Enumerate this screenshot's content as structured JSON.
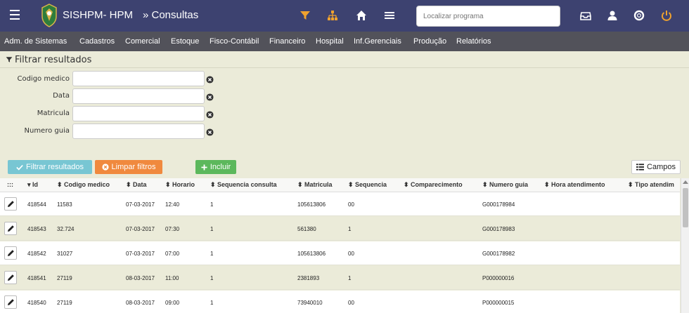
{
  "header": {
    "app_title": "SISHPM- HPM",
    "breadcrumb": "» Consultas",
    "search_placeholder": "Localizar programa",
    "accent_color": "#f0a22e",
    "bar_color": "#3d4270"
  },
  "menu": {
    "items": [
      "Adm. de Sistemas",
      "Cadastros",
      "Comercial",
      "Estoque",
      "Fisco-Contábil",
      "Financeiro",
      "Hospital",
      "Inf.Gerenciais",
      "Produção",
      "Relatórios"
    ]
  },
  "filter": {
    "title": "Filtrar resultados",
    "fields": [
      {
        "label": "Codigo medico",
        "value": ""
      },
      {
        "label": "Data",
        "value": ""
      },
      {
        "label": "Matricula",
        "value": ""
      },
      {
        "label": "Numero guia",
        "value": ""
      }
    ]
  },
  "actions": {
    "filter_label": "Filtrar resultados",
    "clear_label": "Limpar filtros",
    "add_label": "Incluir",
    "fields_label": "Campos"
  },
  "table": {
    "grip": ":::",
    "columns": [
      "Id",
      "Codigo medico",
      "Data",
      "Horario",
      "Sequencia consulta",
      "Matricula",
      "Sequencia",
      "Comparecimento",
      "Numero guia",
      "Hora atendimento",
      "Tipo atendim"
    ],
    "rows": [
      [
        "418544",
        "11583",
        "07-03-2017",
        "12:40",
        "1",
        "105613806",
        "00",
        "",
        "G000178984",
        "",
        ""
      ],
      [
        "418543",
        "32.724",
        "07-03-2017",
        "07:30",
        "1",
        "561380",
        "1",
        "",
        "G000178983",
        "",
        ""
      ],
      [
        "418542",
        "31027",
        "07-03-2017",
        "07:00",
        "1",
        "105613806",
        "00",
        "",
        "G000178982",
        "",
        ""
      ],
      [
        "418541",
        "27119",
        "08-03-2017",
        "11:00",
        "1",
        "2381893",
        "1",
        "",
        "P000000016",
        "",
        ""
      ],
      [
        "418540",
        "27119",
        "08-03-2017",
        "09:00",
        "1",
        "73940010",
        "00",
        "",
        "P000000015",
        "",
        ""
      ]
    ]
  }
}
